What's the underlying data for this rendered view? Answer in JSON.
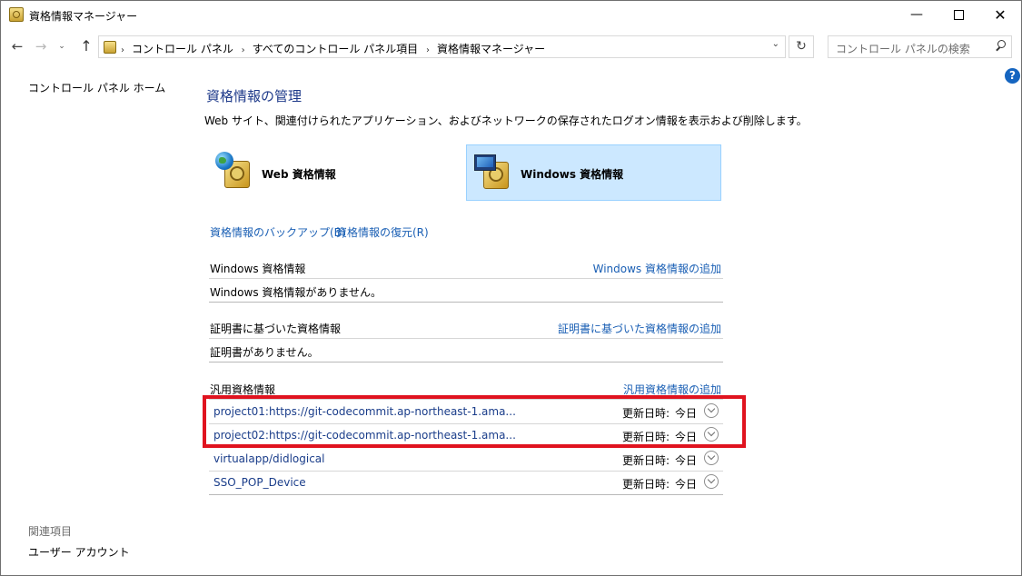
{
  "window": {
    "title": "資格情報マネージャー",
    "minimize": "—",
    "close": "✕"
  },
  "nav": {
    "back": "←",
    "forward": "→",
    "recent": "⌄",
    "up": "↑",
    "breadcrumbs": [
      "コントロール パネル",
      "すべてのコントロール パネル項目",
      "資格情報マネージャー"
    ],
    "refresh": "↻",
    "search_placeholder": "コントロール パネルの検索"
  },
  "help": "?",
  "sidebar": {
    "home": "コントロール パネル ホーム",
    "related_heading": "関連項目",
    "user_accounts": "ユーザー アカウント"
  },
  "main": {
    "title": "資格情報の管理",
    "description": "Web サイト、関連付けられたアプリケーション、およびネットワークの保存されたログオン情報を表示および削除します。",
    "tiles": {
      "web": "Web 資格情報",
      "windows": "Windows 資格情報",
      "selected": "windows"
    },
    "backup_link": "資格情報のバックアップ(B)",
    "restore_link": "資格情報の復元(R)",
    "sections": {
      "windows": {
        "title": "Windows 資格情報",
        "add": "Windows 資格情報の追加",
        "empty": "Windows 資格情報がありません。"
      },
      "certificate": {
        "title": "証明書に基づいた資格情報",
        "add": "証明書に基づいた資格情報の追加",
        "empty": "証明書がありません。"
      },
      "generic": {
        "title": "汎用資格情報",
        "add": "汎用資格情報の追加",
        "items": [
          {
            "name": "project01:https://git-codecommit.ap-northeast-1.ama...",
            "date_label": "更新日時:",
            "date": "今日"
          },
          {
            "name": "project02:https://git-codecommit.ap-northeast-1.ama...",
            "date_label": "更新日時:",
            "date": "今日"
          },
          {
            "name": "virtualapp/didlogical",
            "date_label": "更新日時:",
            "date": "今日"
          },
          {
            "name": "SSO_POP_Device",
            "date_label": "更新日時:",
            "date": "今日"
          }
        ]
      }
    }
  },
  "colors": {
    "link": "#1a5fb4",
    "heading": "#1e3a8a",
    "selected_tile": "#cce8ff",
    "highlight": "#e0131f"
  }
}
